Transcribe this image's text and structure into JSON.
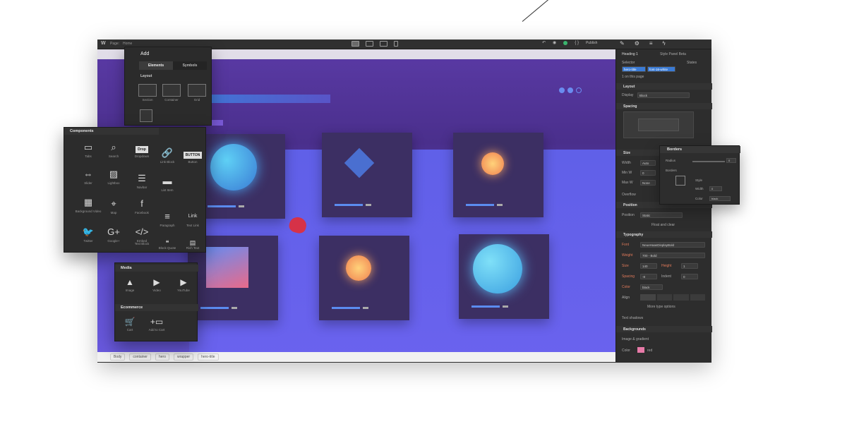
{
  "topbar": {
    "logo": "W",
    "crumbs": [
      "Page:",
      "Home"
    ],
    "publish_label": "Publish",
    "code_icon": "{ }"
  },
  "add_panel": {
    "title": "Add",
    "tabs": [
      "Elements",
      "Symbols"
    ],
    "layout_header": "Layout",
    "layout_items": [
      "Section",
      "Container",
      "Grid"
    ]
  },
  "components": {
    "header": "Components",
    "items": [
      "Tabs",
      "Search",
      "Dropdown",
      "Link Block",
      "Button",
      "Slider",
      "Lightbox",
      "Navbar",
      "List Item",
      "Background Video",
      "Map",
      "Facebook",
      "Paragraph",
      "Text Link",
      "Twitter",
      "Google+",
      "Embed",
      "Text Block",
      "Block Quote",
      "Rich Text"
    ],
    "dropdown_chip": "Drop",
    "button_chip": "BUTTON",
    "link_chip": "Link",
    "google_glyph": "G+"
  },
  "media": {
    "header": "Media",
    "items": [
      "Image",
      "Video",
      "YouTube"
    ],
    "ecommerce_header": "Ecommerce",
    "ecommerce_items": [
      "Cart",
      "Add to Cart"
    ]
  },
  "status_breadcrumb": [
    "Body",
    "container",
    "hero",
    "wrapper",
    "hero-title"
  ],
  "right_panel": {
    "element": "Heading 1",
    "style_panel": "Style Panel Beta",
    "selector_label": "Selector",
    "selector_state": "States",
    "class_tags": [
      "hero-title",
      "font-16-white"
    ],
    "on_page": "1 on this page",
    "layout_header": "Layout",
    "display_label": "Display",
    "display_value": "Block",
    "spacing_header": "Spacing",
    "size_header": "Size",
    "width_label": "Width",
    "width_value": "Auto",
    "minw_label": "Min W",
    "minw_value": "0",
    "maxw_label": "Max W",
    "maxw_value": "None",
    "overflow_label": "Overflow",
    "position_header": "Position",
    "position_label": "Position",
    "position_value": "Static",
    "float_clear": "Float and clear",
    "typography_header": "Typography",
    "font_label": "Font",
    "font_value": "NeueHaasDisplayBold",
    "weight_label": "Weight",
    "weight_value": "700 - Bold",
    "size_label": "Size",
    "size_value": "140",
    "height_label": "Height",
    "height_value": "1",
    "spacing_label": "Spacing",
    "spacing_value": "-8",
    "indent_label": "Indent",
    "indent_value": "0",
    "color_label": "Color",
    "color_value": "black",
    "align_label": "Align",
    "more_type": "More type options",
    "text_shadows": "Text shadows",
    "backgrounds_header": "Backgrounds",
    "image_gradient": "Image & gradient",
    "bg_color_label": "Color",
    "bg_color_value": "red"
  },
  "borders_panel": {
    "header": "Borders",
    "radius_label": "Radius",
    "radius_value": "0",
    "borders_label": "Borders",
    "style_label": "Style",
    "width_label": "Width",
    "width_value": "0",
    "color_label": "Color",
    "color_value": "black"
  },
  "colors": {
    "accent_blue": "#3a7bd5",
    "canvas_purple": "#5a3aa5",
    "card_dark": "#3c2f63",
    "red_shape": "#d63248"
  }
}
